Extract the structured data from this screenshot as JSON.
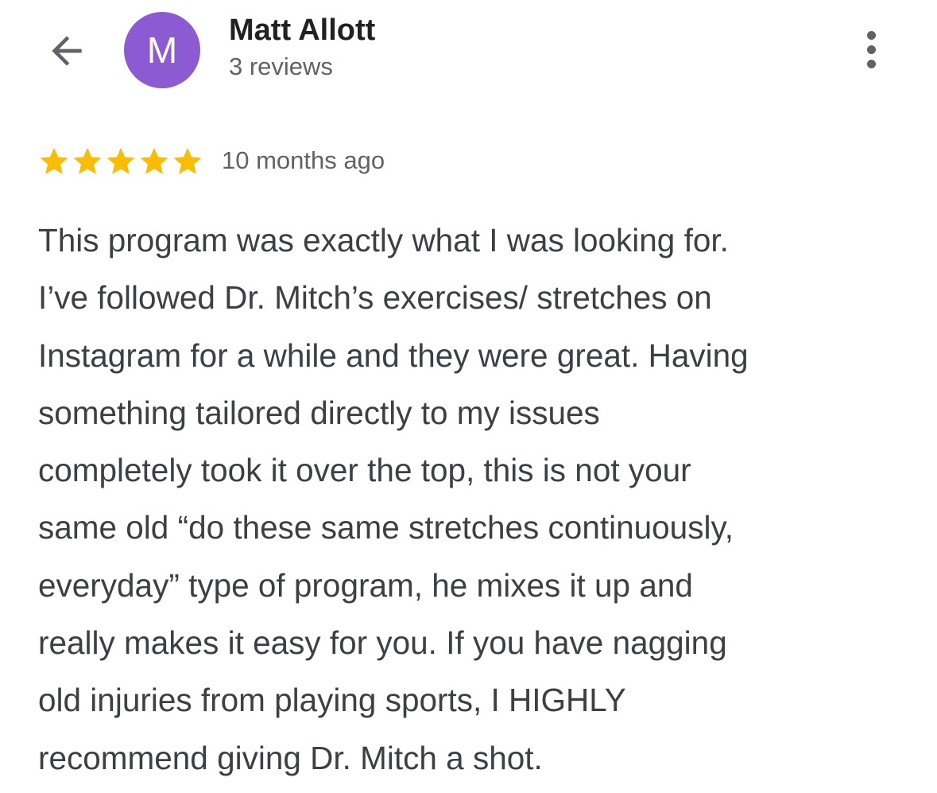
{
  "header": {
    "back_icon": "arrow-left-icon",
    "avatar_letter": "M",
    "avatar_color": "#8c5ad3",
    "user_name": "Matt Allott",
    "review_count": "3 reviews",
    "more_icon": "more-vert-icon"
  },
  "review": {
    "rating": 5,
    "rating_max": 5,
    "star_color": "#fbbc04",
    "time_ago": "10 months ago",
    "text_lines": [
      "This program was exactly what I was looking for.",
      "I’ve followed Dr. Mitch’s exercises/ stretches on",
      "Instagram for a while and they were great. Having",
      "something tailored directly to my issues",
      "completely took it over the top, this is not your",
      "same old “do these same stretches continuously,",
      "everyday” type of program, he mixes it up and",
      "really makes it easy for you. If you have nagging",
      "old injuries from playing sports, I HIGHLY",
      "recommend giving Dr. Mitch a shot."
    ]
  }
}
